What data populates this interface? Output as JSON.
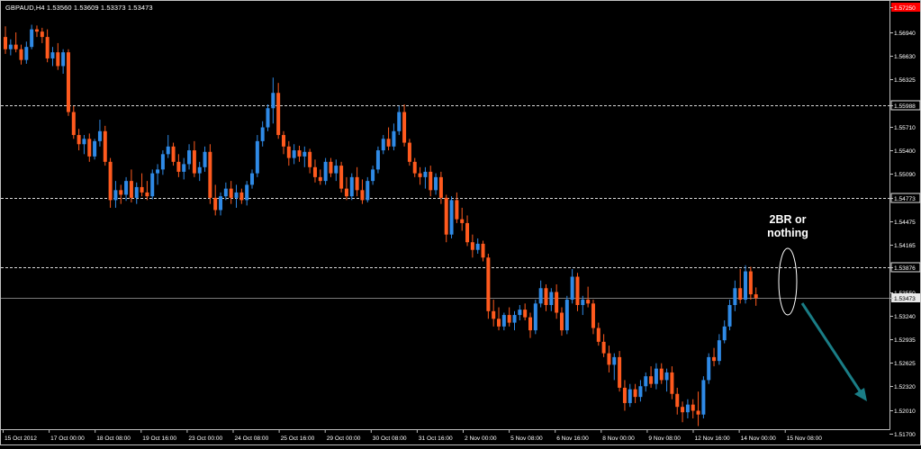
{
  "window": {
    "symbol_info": "GBPAUD,H4  1.53560 1.53609 1.53373 1.53473"
  },
  "colors": {
    "background": "#000000",
    "frame": "#c0c0c0",
    "bull": "#2f8ae6",
    "bear": "#ff5a1e",
    "level_line": "#d8d8d8",
    "arrow": "#1a7d86",
    "current_price_tag": "#e8e8e8",
    "top_marker": "#ff0000"
  },
  "annotation": {
    "text_line1": "2BR or",
    "text_line2": "nothing",
    "shape": "ellipse around last candles",
    "arrow_direction": "down-right"
  },
  "price_axis": {
    "ticks": [
      {
        "label": "1.57250",
        "value": 1.5725
      },
      {
        "label": "1.56940",
        "value": 1.5694
      },
      {
        "label": "1.56630",
        "value": 1.5663
      },
      {
        "label": "1.56325",
        "value": 1.56325
      },
      {
        "label": "1.55988",
        "value": 1.55988,
        "marker": true
      },
      {
        "label": "1.55710",
        "value": 1.5571
      },
      {
        "label": "1.55400",
        "value": 1.554
      },
      {
        "label": "1.55090",
        "value": 1.5509
      },
      {
        "label": "1.54773",
        "value": 1.54773,
        "marker": true
      },
      {
        "label": "1.54475",
        "value": 1.54475
      },
      {
        "label": "1.54165",
        "value": 1.54165
      },
      {
        "label": "1.53876",
        "value": 1.53876,
        "marker": true
      },
      {
        "label": "1.53550",
        "value": 1.5355
      },
      {
        "label": "1.53473",
        "value": 1.53473,
        "current": true
      },
      {
        "label": "1.53240",
        "value": 1.5324
      },
      {
        "label": "1.52935",
        "value": 1.52935
      },
      {
        "label": "1.52625",
        "value": 1.52625
      },
      {
        "label": "1.52320",
        "value": 1.5232
      },
      {
        "label": "1.52010",
        "value": 1.5201
      },
      {
        "label": "1.51700",
        "value": 1.517
      }
    ]
  },
  "time_axis": {
    "labels": [
      "15 Oct 2012",
      "17 Oct 00:00",
      "18 Oct 08:00",
      "19 Oct 16:00",
      "23 Oct 00:00",
      "24 Oct 08:00",
      "25 Oct 16:00",
      "29 Oct 00:00",
      "30 Oct 08:00",
      "31 Oct 16:00",
      "2 Nov 00:00",
      "5 Nov 08:00",
      "6 Nov 16:00",
      "8 Nov 00:00",
      "9 Nov 08:00",
      "12 Nov 16:00",
      "14 Nov 00:00",
      "15 Nov 08:00"
    ]
  },
  "horizontal_levels": [
    1.55988,
    1.54773,
    1.53876
  ],
  "chart_data": {
    "type": "candlestick",
    "symbol": "GBPAUD",
    "timeframe": "H4",
    "ylim": [
      1.5167,
      1.5728
    ],
    "last_price": 1.53473,
    "series": [
      {
        "name": "GBPAUD",
        "candles": [
          [
            1.5688,
            1.5702,
            1.5666,
            1.5672
          ],
          [
            1.5672,
            1.5685,
            1.5664,
            1.5678
          ],
          [
            1.5678,
            1.5694,
            1.5668,
            1.5672
          ],
          [
            1.5672,
            1.5678,
            1.5652,
            1.5658
          ],
          [
            1.5658,
            1.5682,
            1.5653,
            1.5675
          ],
          [
            1.5675,
            1.5704,
            1.5672,
            1.5698
          ],
          [
            1.5698,
            1.5703,
            1.5688,
            1.5695
          ],
          [
            1.5695,
            1.57,
            1.568,
            1.5688
          ],
          [
            1.5688,
            1.5698,
            1.5655,
            1.566
          ],
          [
            1.566,
            1.5675,
            1.565,
            1.5668
          ],
          [
            1.5668,
            1.568,
            1.5645,
            1.565
          ],
          [
            1.565,
            1.5672,
            1.564,
            1.5668
          ],
          [
            1.5668,
            1.5672,
            1.5585,
            1.559
          ],
          [
            1.559,
            1.5598,
            1.5555,
            1.556
          ],
          [
            1.556,
            1.5568,
            1.554,
            1.5548
          ],
          [
            1.5548,
            1.556,
            1.5535,
            1.5555
          ],
          [
            1.5555,
            1.5562,
            1.5525,
            1.5532
          ],
          [
            1.5532,
            1.5555,
            1.5528,
            1.5552
          ],
          [
            1.5552,
            1.558,
            1.5545,
            1.5565
          ],
          [
            1.5565,
            1.5572,
            1.552,
            1.5525
          ],
          [
            1.5525,
            1.553,
            1.5465,
            1.5475
          ],
          [
            1.5475,
            1.55,
            1.5465,
            1.5488
          ],
          [
            1.5488,
            1.5495,
            1.547,
            1.5482
          ],
          [
            1.5482,
            1.5505,
            1.5474,
            1.55
          ],
          [
            1.55,
            1.5515,
            1.5472,
            1.5478
          ],
          [
            1.5478,
            1.5498,
            1.547,
            1.5492
          ],
          [
            1.5492,
            1.551,
            1.548,
            1.5485
          ],
          [
            1.5485,
            1.55,
            1.5475,
            1.548
          ],
          [
            1.548,
            1.5515,
            1.5476,
            1.551
          ],
          [
            1.551,
            1.5522,
            1.5495,
            1.5515
          ],
          [
            1.5515,
            1.554,
            1.5508,
            1.5535
          ],
          [
            1.5535,
            1.556,
            1.553,
            1.5545
          ],
          [
            1.5545,
            1.555,
            1.552,
            1.5525
          ],
          [
            1.5525,
            1.5535,
            1.5505,
            1.5512
          ],
          [
            1.5512,
            1.553,
            1.5502,
            1.5522
          ],
          [
            1.5522,
            1.5548,
            1.5515,
            1.554
          ],
          [
            1.554,
            1.5552,
            1.5505,
            1.551
          ],
          [
            1.551,
            1.5525,
            1.55,
            1.5518
          ],
          [
            1.5518,
            1.5545,
            1.5512,
            1.5538
          ],
          [
            1.5538,
            1.5548,
            1.547,
            1.5478
          ],
          [
            1.5478,
            1.5495,
            1.5455,
            1.5462
          ],
          [
            1.5462,
            1.5485,
            1.5455,
            1.548
          ],
          [
            1.548,
            1.5498,
            1.5475,
            1.549
          ],
          [
            1.549,
            1.55,
            1.547,
            1.5478
          ],
          [
            1.5478,
            1.5495,
            1.5465,
            1.5485
          ],
          [
            1.5485,
            1.549,
            1.547,
            1.5475
          ],
          [
            1.5475,
            1.55,
            1.5468,
            1.5495
          ],
          [
            1.5495,
            1.5515,
            1.549,
            1.551
          ],
          [
            1.551,
            1.556,
            1.5505,
            1.5552
          ],
          [
            1.5552,
            1.5578,
            1.5545,
            1.557
          ],
          [
            1.557,
            1.56,
            1.5565,
            1.5595
          ],
          [
            1.5595,
            1.5635,
            1.5575,
            1.5615
          ],
          [
            1.5615,
            1.5628,
            1.5555,
            1.556
          ],
          [
            1.556,
            1.5565,
            1.5535,
            1.5545
          ],
          [
            1.5545,
            1.5552,
            1.552,
            1.553
          ],
          [
            1.553,
            1.5548,
            1.5522,
            1.554
          ],
          [
            1.554,
            1.5546,
            1.5525,
            1.5532
          ],
          [
            1.5532,
            1.5545,
            1.5518,
            1.5538
          ],
          [
            1.5538,
            1.5542,
            1.551,
            1.5518
          ],
          [
            1.5518,
            1.5528,
            1.5498,
            1.5505
          ],
          [
            1.5505,
            1.5515,
            1.5495,
            1.55
          ],
          [
            1.55,
            1.553,
            1.5495,
            1.5525
          ],
          [
            1.5525,
            1.553,
            1.5505,
            1.551
          ],
          [
            1.551,
            1.5528,
            1.55,
            1.552
          ],
          [
            1.552,
            1.5525,
            1.5485,
            1.549
          ],
          [
            1.549,
            1.5505,
            1.5475,
            1.548
          ],
          [
            1.548,
            1.551,
            1.5475,
            1.5505
          ],
          [
            1.5505,
            1.5518,
            1.548,
            1.5488
          ],
          [
            1.5488,
            1.5502,
            1.547,
            1.5475
          ],
          [
            1.5475,
            1.5505,
            1.5472,
            1.55
          ],
          [
            1.55,
            1.552,
            1.5495,
            1.5515
          ],
          [
            1.5515,
            1.5545,
            1.551,
            1.554
          ],
          [
            1.554,
            1.556,
            1.5535,
            1.5555
          ],
          [
            1.5555,
            1.557,
            1.554,
            1.5545
          ],
          [
            1.5545,
            1.5575,
            1.554,
            1.5565
          ],
          [
            1.5565,
            1.5598,
            1.556,
            1.559
          ],
          [
            1.559,
            1.56,
            1.5545,
            1.555
          ],
          [
            1.555,
            1.5555,
            1.552,
            1.5525
          ],
          [
            1.5525,
            1.553,
            1.5505,
            1.551
          ],
          [
            1.551,
            1.5518,
            1.5495,
            1.5505
          ],
          [
            1.5505,
            1.5518,
            1.549,
            1.5512
          ],
          [
            1.5512,
            1.552,
            1.548,
            1.5488
          ],
          [
            1.5488,
            1.551,
            1.5482,
            1.5505
          ],
          [
            1.5505,
            1.5512,
            1.547,
            1.5478
          ],
          [
            1.5478,
            1.5482,
            1.542,
            1.543
          ],
          [
            1.543,
            1.548,
            1.5425,
            1.5475
          ],
          [
            1.5475,
            1.5485,
            1.5445,
            1.545
          ],
          [
            1.545,
            1.5465,
            1.5435,
            1.5445
          ],
          [
            1.5445,
            1.5455,
            1.5415,
            1.542
          ],
          [
            1.542,
            1.543,
            1.54,
            1.541
          ],
          [
            1.541,
            1.5425,
            1.5405,
            1.5418
          ],
          [
            1.5418,
            1.5422,
            1.5395,
            1.54
          ],
          [
            1.54,
            1.5405,
            1.532,
            1.533
          ],
          [
            1.533,
            1.5345,
            1.531,
            1.532
          ],
          [
            1.532,
            1.5335,
            1.5305,
            1.531
          ],
          [
            1.531,
            1.5328,
            1.5305,
            1.5325
          ],
          [
            1.5325,
            1.5335,
            1.531,
            1.5315
          ],
          [
            1.5315,
            1.533,
            1.5305,
            1.5325
          ],
          [
            1.5325,
            1.5338,
            1.5318,
            1.5332
          ],
          [
            1.5332,
            1.534,
            1.5318,
            1.5322
          ],
          [
            1.5322,
            1.5328,
            1.5295,
            1.5305
          ],
          [
            1.5305,
            1.5345,
            1.53,
            1.534
          ],
          [
            1.534,
            1.537,
            1.5335,
            1.536
          ],
          [
            1.536,
            1.5365,
            1.533,
            1.5338
          ],
          [
            1.5338,
            1.536,
            1.533,
            1.5355
          ],
          [
            1.5355,
            1.5365,
            1.532,
            1.5328
          ],
          [
            1.5328,
            1.5335,
            1.5298,
            1.5305
          ],
          [
            1.5305,
            1.535,
            1.53,
            1.5345
          ],
          [
            1.5345,
            1.5385,
            1.534,
            1.5375
          ],
          [
            1.5375,
            1.538,
            1.533,
            1.5338
          ],
          [
            1.5338,
            1.535,
            1.5325,
            1.5345
          ],
          [
            1.5345,
            1.5362,
            1.5335,
            1.534
          ],
          [
            1.534,
            1.5345,
            1.53,
            1.5308
          ],
          [
            1.5308,
            1.5315,
            1.5285,
            1.529
          ],
          [
            1.529,
            1.53,
            1.527,
            1.5275
          ],
          [
            1.5275,
            1.5285,
            1.525,
            1.526
          ],
          [
            1.526,
            1.5275,
            1.524,
            1.527
          ],
          [
            1.527,
            1.5278,
            1.5225,
            1.523
          ],
          [
            1.523,
            1.524,
            1.52,
            1.521
          ],
          [
            1.521,
            1.5235,
            1.5205,
            1.5228
          ],
          [
            1.5228,
            1.5235,
            1.521,
            1.5218
          ],
          [
            1.5218,
            1.524,
            1.5212,
            1.5232
          ],
          [
            1.5232,
            1.525,
            1.5225,
            1.5245
          ],
          [
            1.5245,
            1.5258,
            1.523,
            1.5235
          ],
          [
            1.5235,
            1.5262,
            1.5228,
            1.5255
          ],
          [
            1.5255,
            1.5262,
            1.5235,
            1.524
          ],
          [
            1.524,
            1.5255,
            1.5225,
            1.525
          ],
          [
            1.525,
            1.5258,
            1.5215,
            1.5222
          ],
          [
            1.5222,
            1.523,
            1.5195,
            1.5205
          ],
          [
            1.5205,
            1.5212,
            1.5185,
            1.5198
          ],
          [
            1.5198,
            1.5215,
            1.519,
            1.5208
          ],
          [
            1.5208,
            1.5215,
            1.519,
            1.52
          ],
          [
            1.52,
            1.5225,
            1.518,
            1.5195
          ],
          [
            1.5195,
            1.5245,
            1.519,
            1.524
          ],
          [
            1.524,
            1.5275,
            1.5235,
            1.527
          ],
          [
            1.527,
            1.5282,
            1.5258,
            1.5265
          ],
          [
            1.5265,
            1.53,
            1.526,
            1.5292
          ],
          [
            1.5292,
            1.5318,
            1.5288,
            1.531
          ],
          [
            1.531,
            1.5345,
            1.5305,
            1.5338
          ],
          [
            1.5338,
            1.537,
            1.533,
            1.536
          ],
          [
            1.536,
            1.5385,
            1.534,
            1.5345
          ],
          [
            1.5345,
            1.539,
            1.534,
            1.5382
          ],
          [
            1.5382,
            1.5388,
            1.5345,
            1.5352
          ],
          [
            1.5352,
            1.5361,
            1.5337,
            1.5347
          ]
        ]
      }
    ]
  }
}
